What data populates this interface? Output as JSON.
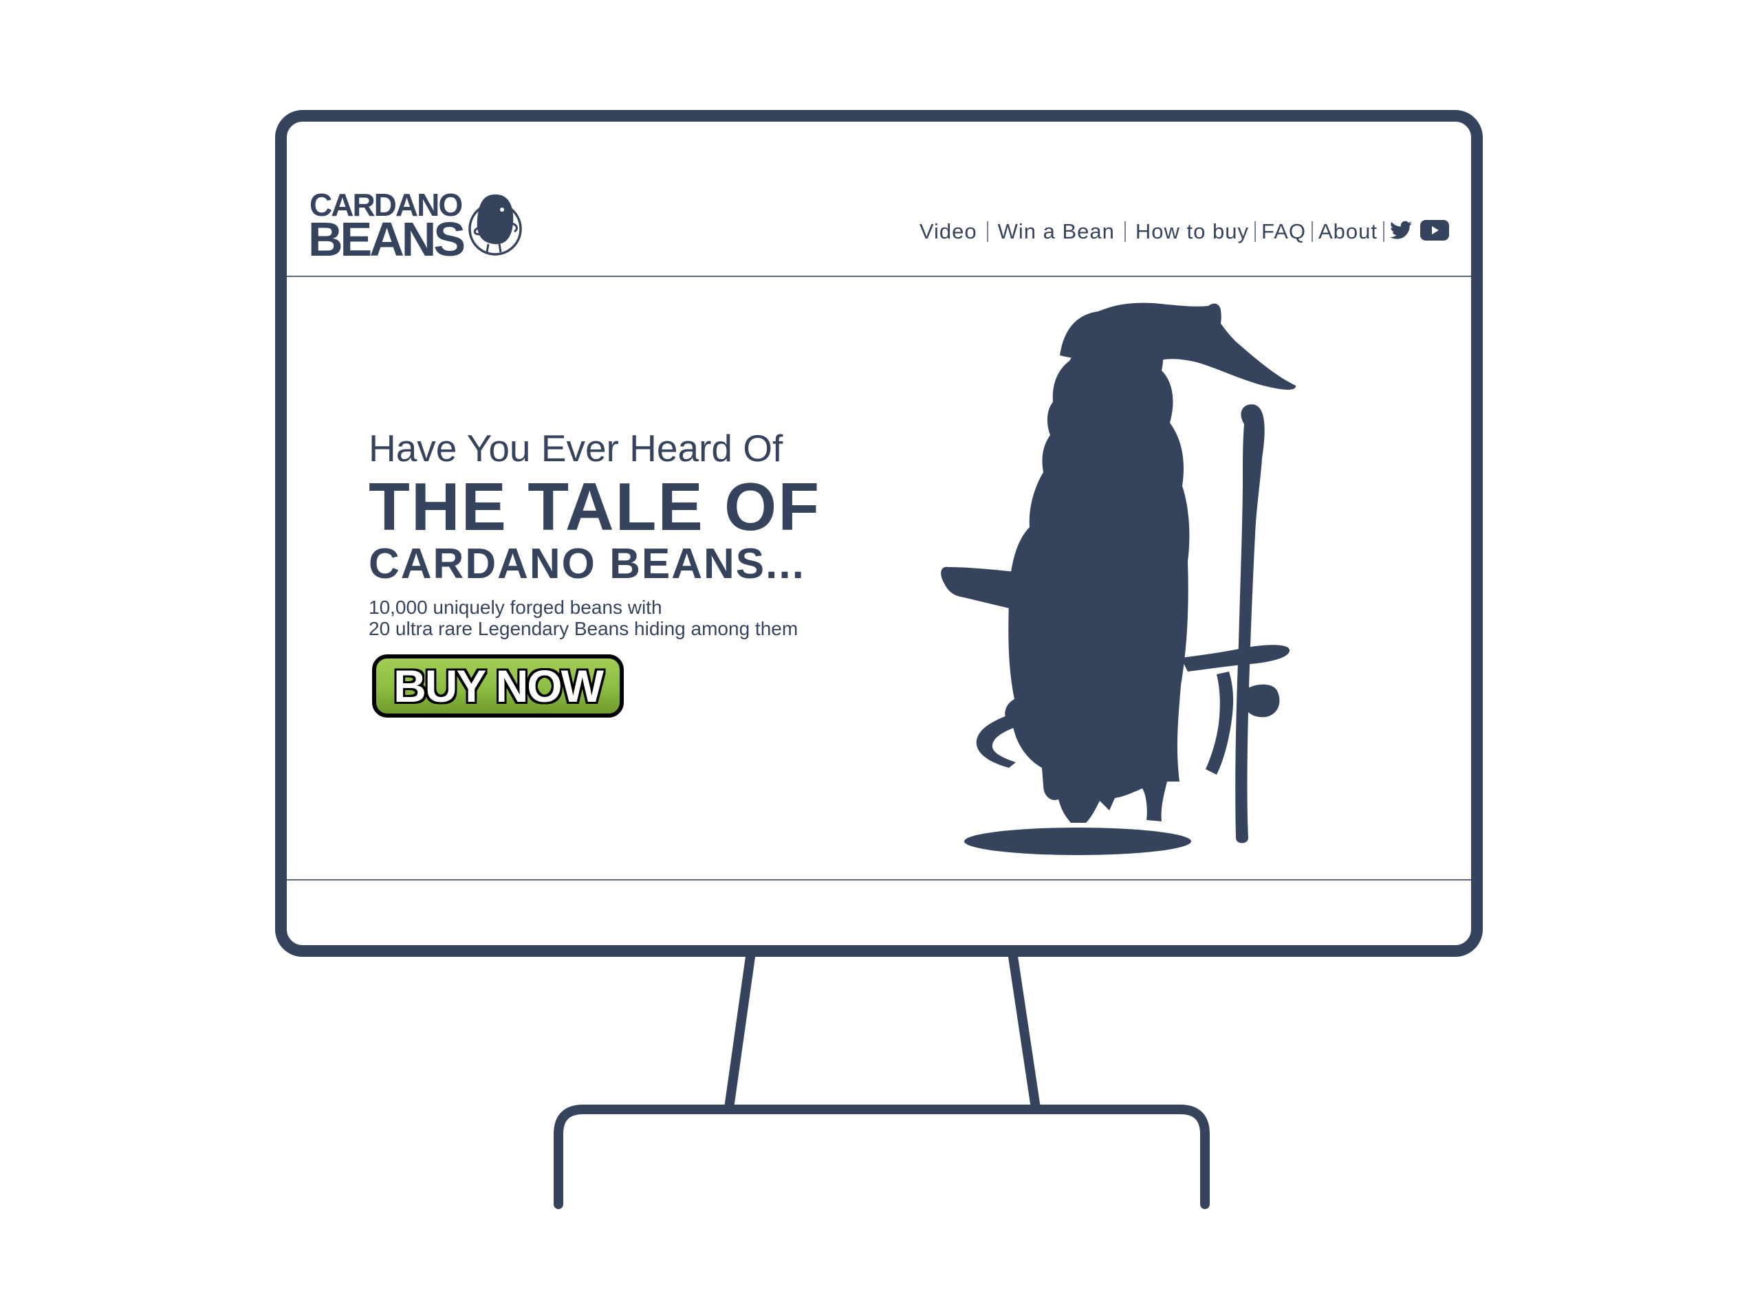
{
  "colors": {
    "primary": "#35435d",
    "button_green": "#8cbd42",
    "button_border": "#000000",
    "background": "#ffffff"
  },
  "logo": {
    "line1": "CARDANO",
    "line2": "BEANS",
    "mascot_icon": "bean-mascot-icon"
  },
  "nav": {
    "items": [
      {
        "label": "Video"
      },
      {
        "label": "Win a Bean"
      },
      {
        "label": "How to buy"
      },
      {
        "label": "FAQ"
      },
      {
        "label": "About"
      }
    ],
    "social": [
      {
        "icon": "twitter-icon"
      },
      {
        "icon": "youtube-icon"
      }
    ]
  },
  "hero": {
    "kicker": "Have You Ever Heard Of",
    "headline": "THE TALE OF",
    "subhead": "CARDANO BEANS...",
    "desc_line1": "10,000 uniquely forged beans with",
    "desc_line2": "20 ultra rare Legendary Beans hiding among them",
    "cta_label": "BUY NOW",
    "illustration": "wizard-bean-silhouette"
  }
}
